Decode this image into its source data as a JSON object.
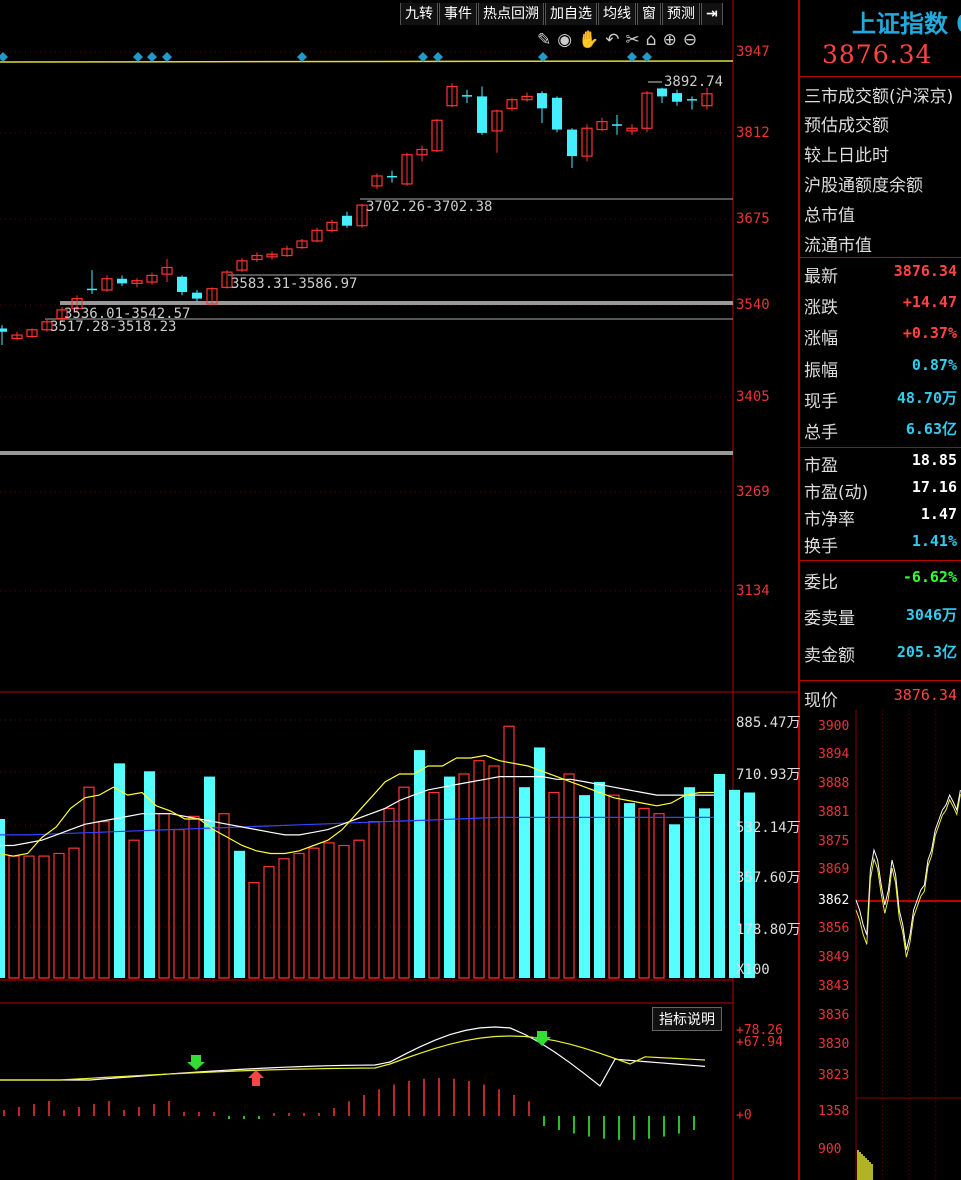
{
  "toolbar": {
    "buttons": [
      "九转",
      "事件",
      "热点回溯",
      "加自选",
      "均线",
      "窗",
      "预测"
    ],
    "exit_icon": "exit-icon",
    "icons": [
      "pen-icon",
      "eye-icon",
      "hand-icon",
      "undo-icon",
      "scissors-icon",
      "lock-icon",
      "zoom-in-icon",
      "zoom-out-icon"
    ]
  },
  "main_chart": {
    "y_ticks": [
      "3947",
      "3812",
      "3675",
      "3540",
      "3405",
      "3269",
      "3134"
    ],
    "annotations": {
      "high": "3892.74",
      "gap1": "3702.26-3702.38",
      "gap2": "3583.31-3586.97",
      "gap3": "3536.01-3542.57",
      "gap4": "3517.28-3518.23"
    }
  },
  "volume_chart": {
    "y_ticks": [
      "885.47万",
      "710.93万",
      "532.14万",
      "357.60万",
      "178.80万"
    ],
    "unit": "X100"
  },
  "indicator_chart": {
    "button": "指标说明",
    "labels": [
      "+78.26",
      "+67.94",
      "+0"
    ]
  },
  "right_panel": {
    "title": "上证指数",
    "price": "3876.34",
    "info_lines": [
      "三市成交额(沪深京)",
      "预估成交额",
      "较上日此时",
      "沪股通额度余额",
      "总市值",
      "流通市值"
    ],
    "stats": [
      {
        "label": "最新",
        "value": "3876.34",
        "color": "red"
      },
      {
        "label": "涨跌",
        "value": "+14.47",
        "color": "red"
      },
      {
        "label": "涨幅",
        "value": "+0.37%",
        "color": "red"
      },
      {
        "label": "振幅",
        "value": "0.87%",
        "color": "cyan"
      },
      {
        "label": "现手",
        "value": "48.70万",
        "color": "cyan"
      },
      {
        "label": "总手",
        "value": "6.63亿",
        "color": "cyan"
      },
      {
        "label": "市盈",
        "value": "18.85",
        "color": "white"
      },
      {
        "label": "市盈(动)",
        "value": "17.16",
        "color": "white"
      },
      {
        "label": "市净率",
        "value": "1.47",
        "color": "white"
      },
      {
        "label": "换手",
        "value": "1.41%",
        "color": "cyan"
      },
      {
        "label": "委比",
        "value": "-6.62%",
        "color": "green"
      },
      {
        "label": "委卖量",
        "value": "3046万",
        "color": "cyan"
      },
      {
        "label": "卖金额",
        "value": "205.3亿",
        "color": "cyan"
      }
    ],
    "current_label": "现价",
    "current_value": "3876.34",
    "mini_ticks": [
      "3900",
      "3894",
      "3888",
      "3881",
      "3875",
      "3869",
      "3862",
      "3856",
      "3849",
      "3843",
      "3836",
      "3830",
      "3823",
      "1358",
      "900"
    ]
  },
  "chart_data": {
    "type": "candlestick",
    "ylim": [
      3134,
      3947
    ],
    "candles": [
      {
        "o": 3525,
        "c": 3530,
        "h": 3535,
        "l": 3505,
        "up": false
      },
      {
        "o": 3515,
        "c": 3520,
        "h": 3525,
        "l": 3512,
        "up": true
      },
      {
        "o": 3518,
        "c": 3528,
        "h": 3530,
        "l": 3516,
        "up": true
      },
      {
        "o": 3528,
        "c": 3540,
        "h": 3545,
        "l": 3525,
        "up": true
      },
      {
        "o": 3545,
        "c": 3558,
        "h": 3562,
        "l": 3540,
        "up": true
      },
      {
        "o": 3560,
        "c": 3575,
        "h": 3580,
        "l": 3555,
        "up": true
      },
      {
        "o": 3588,
        "c": 3590,
        "h": 3618,
        "l": 3582,
        "up": false
      },
      {
        "o": 3588,
        "c": 3605,
        "h": 3610,
        "l": 3585,
        "up": true
      },
      {
        "o": 3605,
        "c": 3598,
        "h": 3610,
        "l": 3594,
        "up": false
      },
      {
        "o": 3598,
        "c": 3602,
        "h": 3606,
        "l": 3592,
        "up": true
      },
      {
        "o": 3600,
        "c": 3610,
        "h": 3614,
        "l": 3596,
        "up": true
      },
      {
        "o": 3612,
        "c": 3622,
        "h": 3635,
        "l": 3600,
        "up": true
      },
      {
        "o": 3608,
        "c": 3585,
        "h": 3610,
        "l": 3580,
        "up": false
      },
      {
        "o": 3584,
        "c": 3575,
        "h": 3588,
        "l": 3570,
        "up": false
      },
      {
        "o": 3567,
        "c": 3590,
        "h": 3592,
        "l": 3565,
        "up": true
      },
      {
        "o": 3592,
        "c": 3615,
        "h": 3618,
        "l": 3590,
        "up": true
      },
      {
        "o": 3618,
        "c": 3632,
        "h": 3636,
        "l": 3615,
        "up": true
      },
      {
        "o": 3634,
        "c": 3640,
        "h": 3645,
        "l": 3630,
        "up": true
      },
      {
        "o": 3638,
        "c": 3642,
        "h": 3646,
        "l": 3634,
        "up": true
      },
      {
        "o": 3640,
        "c": 3650,
        "h": 3655,
        "l": 3638,
        "up": true
      },
      {
        "o": 3652,
        "c": 3662,
        "h": 3665,
        "l": 3650,
        "up": true
      },
      {
        "o": 3662,
        "c": 3678,
        "h": 3682,
        "l": 3660,
        "up": true
      },
      {
        "o": 3678,
        "c": 3690,
        "h": 3694,
        "l": 3675,
        "up": true
      },
      {
        "o": 3700,
        "c": 3685,
        "h": 3706,
        "l": 3682,
        "up": false
      },
      {
        "o": 3685,
        "c": 3716,
        "h": 3718,
        "l": 3682,
        "up": true
      },
      {
        "o": 3745,
        "c": 3760,
        "h": 3764,
        "l": 3740,
        "up": true
      },
      {
        "o": 3758,
        "c": 3760,
        "h": 3768,
        "l": 3750,
        "up": false
      },
      {
        "o": 3748,
        "c": 3792,
        "h": 3795,
        "l": 3745,
        "up": true
      },
      {
        "o": 3792,
        "c": 3800,
        "h": 3806,
        "l": 3782,
        "up": true
      },
      {
        "o": 3798,
        "c": 3844,
        "h": 3846,
        "l": 3796,
        "up": true
      },
      {
        "o": 3866,
        "c": 3895,
        "h": 3900,
        "l": 3864,
        "up": true
      },
      {
        "o": 3880,
        "c": 3882,
        "h": 3890,
        "l": 3870,
        "up": false
      },
      {
        "o": 3880,
        "c": 3825,
        "h": 3895,
        "l": 3822,
        "up": false
      },
      {
        "o": 3828,
        "c": 3858,
        "h": 3860,
        "l": 3795,
        "up": true
      },
      {
        "o": 3862,
        "c": 3875,
        "h": 3878,
        "l": 3858,
        "up": true
      },
      {
        "o": 3875,
        "c": 3880,
        "h": 3886,
        "l": 3872,
        "up": true
      },
      {
        "o": 3885,
        "c": 3862,
        "h": 3888,
        "l": 3840,
        "up": false
      },
      {
        "o": 3878,
        "c": 3830,
        "h": 3880,
        "l": 3826,
        "up": false
      },
      {
        "o": 3830,
        "c": 3790,
        "h": 3832,
        "l": 3772,
        "up": false
      },
      {
        "o": 3790,
        "c": 3832,
        "h": 3838,
        "l": 3782,
        "up": true
      },
      {
        "o": 3830,
        "c": 3842,
        "h": 3848,
        "l": 3828,
        "up": true
      },
      {
        "o": 3836,
        "c": 3838,
        "h": 3852,
        "l": 3822,
        "up": false
      },
      {
        "o": 3828,
        "c": 3832,
        "h": 3838,
        "l": 3822,
        "up": true
      },
      {
        "o": 3832,
        "c": 3885,
        "h": 3888,
        "l": 3826,
        "up": true
      },
      {
        "o": 3892,
        "c": 3880,
        "h": 3893,
        "l": 3870,
        "up": false
      },
      {
        "o": 3885,
        "c": 3872,
        "h": 3890,
        "l": 3866,
        "up": false
      },
      {
        "o": 3876,
        "c": 3876,
        "h": 3880,
        "l": 3860,
        "up": false
      },
      {
        "o": 3866,
        "c": 3884,
        "h": 3893,
        "l": 3860,
        "up": true
      }
    ],
    "volume": {
      "ylim": [
        0,
        1000
      ],
      "values": [
        600,
        460,
        460,
        460,
        470,
        490,
        720,
        590,
        810,
        520,
        780,
        620,
        560,
        610,
        760,
        620,
        480,
        360,
        420,
        450,
        470,
        490,
        510,
        500,
        520,
        590,
        640,
        720,
        860,
        700,
        760,
        770,
        820,
        800,
        950,
        720,
        870,
        700,
        770,
        690,
        740,
        690,
        660,
        640,
        620,
        580,
        720,
        640,
        770,
        710,
        700
      ],
      "up": [
        false,
        true,
        true,
        true,
        true,
        true,
        true,
        true,
        false,
        true,
        false,
        true,
        true,
        true,
        false,
        true,
        false,
        true,
        true,
        true,
        true,
        true,
        true,
        true,
        true,
        true,
        true,
        true,
        false,
        true,
        false,
        true,
        true,
        true,
        true,
        false,
        false,
        true,
        true,
        false,
        false,
        true,
        false,
        true,
        true,
        false,
        false,
        false,
        false,
        false,
        false
      ],
      "ma5": [
        470,
        460,
        470,
        530,
        570,
        640,
        680,
        690,
        720,
        690,
        700,
        650,
        630,
        600,
        600,
        560,
        530,
        500,
        480,
        470,
        470,
        480,
        500,
        520,
        560,
        620,
        680,
        740,
        770,
        770,
        800,
        800,
        830,
        830,
        840,
        820,
        810,
        800,
        780,
        760,
        740,
        720,
        700,
        680,
        670,
        660,
        650,
        660,
        690,
        700,
        700
      ],
      "ma10": [
        500,
        500,
        510,
        520,
        540,
        560,
        580,
        590,
        600,
        610,
        620,
        620,
        620,
        610,
        600,
        590,
        580,
        570,
        560,
        550,
        540,
        540,
        550,
        560,
        580,
        600,
        620,
        640,
        670,
        690,
        710,
        720,
        730,
        740,
        750,
        760,
        760,
        760,
        760,
        750,
        750,
        740,
        730,
        720,
        710,
        700,
        690,
        690,
        690,
        690,
        690
      ],
      "ma60": [
        540,
        540,
        540,
        542,
        544,
        546,
        548,
        550,
        552,
        554,
        556,
        558,
        560,
        562,
        564,
        566,
        568,
        570,
        572,
        574,
        576,
        578,
        580,
        582,
        584,
        586,
        588,
        590,
        592,
        594,
        596,
        598,
        600,
        602,
        604,
        606,
        606,
        606,
        606,
        606,
        606,
        606,
        606,
        606,
        606,
        606,
        606,
        606,
        606,
        606,
        606
      ]
    }
  }
}
